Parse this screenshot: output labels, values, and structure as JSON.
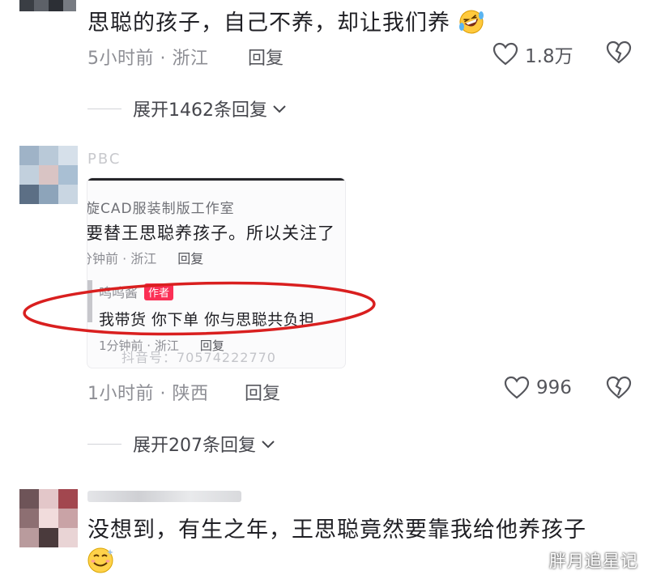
{
  "comments": [
    {
      "text": "思聪的孩子，自己不养，却让我们养",
      "emoji_icon": "rofl-emoji-icon",
      "time": "5小时前",
      "location": "浙江",
      "reply_label": "回复",
      "likes": "1.8万",
      "expand_label": "展开1462条回复"
    },
    {
      "username": "PBC",
      "time": "1小时前",
      "location": "陕西",
      "reply_label": "回复",
      "likes": "996",
      "expand_label": "展开207条回复",
      "embedded_screenshot": {
        "title": "旋CAD服装制版工作室",
        "comment": "要替王思聪养孩子。所以关注了",
        "meta": "分钟前 · 浙江",
        "reply_label": "回复",
        "author": "呜呜酱",
        "author_badge": "作者",
        "author_reply": "我带货 你下单 你与思聪共负担",
        "author_meta": "1分钟前 · 浙江",
        "author_reply_label": "回复",
        "watermark": "抖音号：70574222770"
      }
    },
    {
      "text_line1": "没想到，有生之年，王思聪竟然要靠我给他养孩子",
      "emoji_icon": "smile-emoji-icon"
    }
  ],
  "page_watermark": "胖月追星记",
  "colors": {
    "highlight_ellipse": "#d91f1f",
    "author_badge": "#fb2f55",
    "meta_text": "#8d8e94"
  }
}
